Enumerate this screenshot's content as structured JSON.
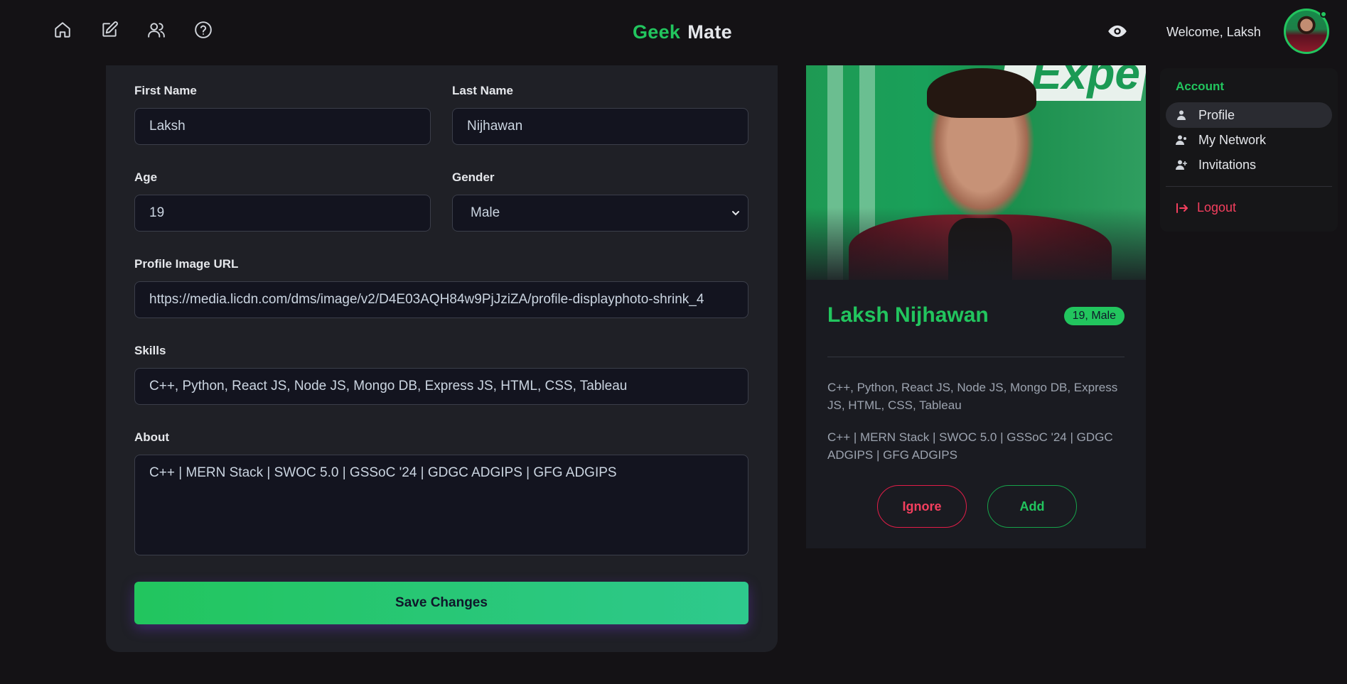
{
  "app": {
    "brand_first": "Geek",
    "brand_second": "Mate",
    "welcome": "Welcome, Laksh",
    "accent": "#22c55e",
    "danger": "#f43f5e"
  },
  "nav": {
    "icons": [
      "home-icon",
      "edit-icon",
      "users-icon",
      "help-icon"
    ]
  },
  "form": {
    "first_name_label": "First Name",
    "first_name_value": "Laksh",
    "last_name_label": "Last Name",
    "last_name_value": "Nijhawan",
    "age_label": "Age",
    "age_value": "19",
    "gender_label": "Gender",
    "gender_value": "Male",
    "image_url_label": "Profile Image URL",
    "image_url_value": "https://media.licdn.com/dms/image/v2/D4E03AQH84w9PjJziZA/profile-displayphoto-shrink_4",
    "skills_label": "Skills",
    "skills_value": "C++, Python, React JS, Node JS, Mongo DB, Express JS, HTML, CSS, Tableau",
    "about_label": "About",
    "about_value": "C++ | MERN Stack | SWOC 5.0 | GSSoC '24 | GDGC ADGIPS | GFG ADGIPS",
    "save_label": "Save Changes"
  },
  "preview": {
    "banner_text": "Expe",
    "name": "Laksh Nijhawan",
    "badge": "19, Male",
    "skills": "C++, Python, React JS, Node JS, Mongo DB, Express JS, HTML, CSS, Tableau",
    "about": "C++ | MERN Stack | SWOC 5.0 | GSSoC '24 | GDGC ADGIPS | GFG ADGIPS",
    "ignore_label": "Ignore",
    "add_label": "Add"
  },
  "dropdown": {
    "title": "Account",
    "items": [
      {
        "label": "Profile",
        "icon": "user-icon",
        "active": true
      },
      {
        "label": "My Network",
        "icon": "user-network-icon",
        "active": false
      },
      {
        "label": "Invitations",
        "icon": "user-plus-icon",
        "active": false
      }
    ],
    "logout_label": "Logout"
  }
}
